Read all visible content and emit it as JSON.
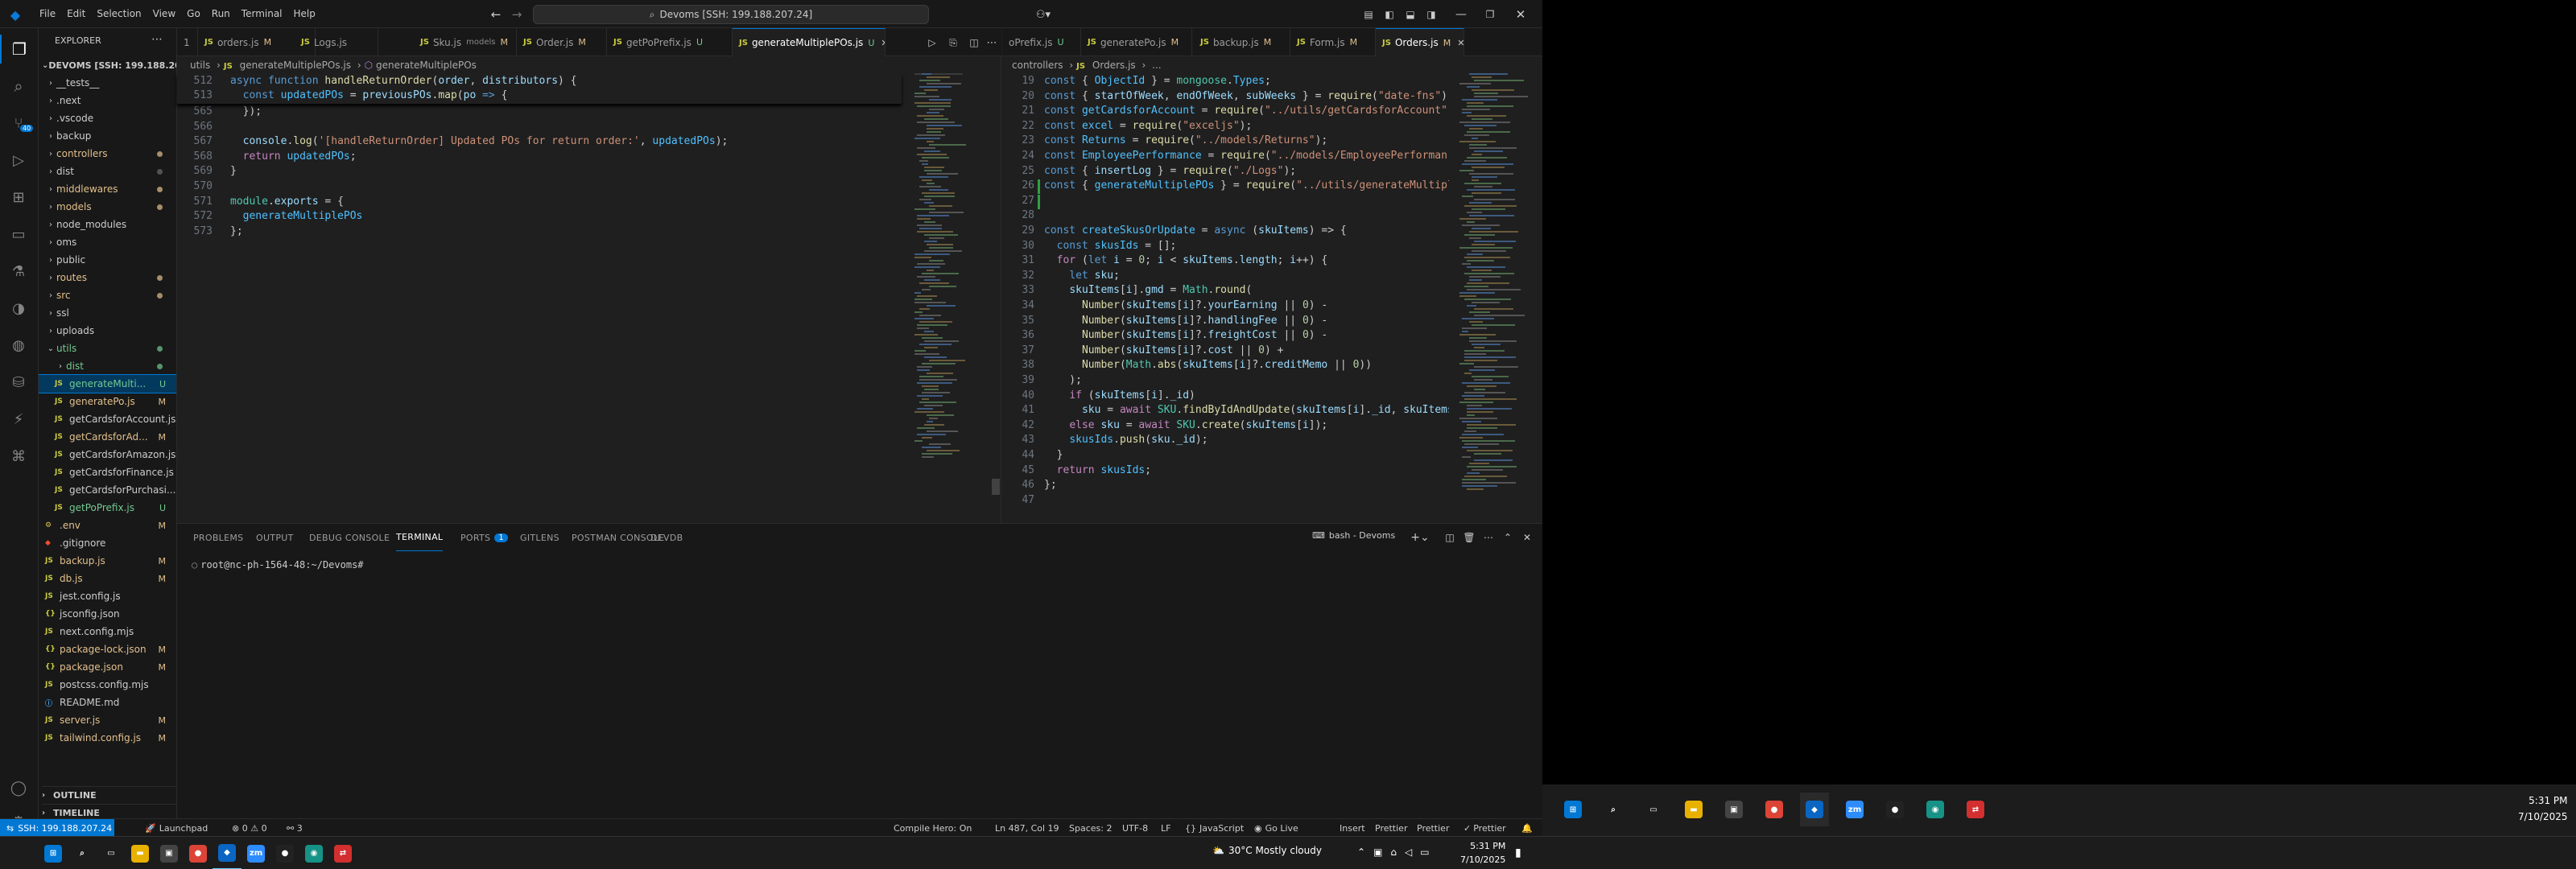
{
  "menu": {
    "file": "File",
    "edit": "Edit",
    "selection": "Selection",
    "view": "View",
    "go": "Go",
    "run": "Run",
    "terminal": "Terminal",
    "help": "Help"
  },
  "search": {
    "text": "Devoms [SSH: 199.188.207.24]"
  },
  "explorer": {
    "title": "EXPLORER",
    "root": "DEVOMS [SSH: 199.188.20...",
    "outline": "OUTLINE",
    "timeline": "TIMELINE",
    "items": [
      {
        "label": "__tests__",
        "type": "folder",
        "depth": 1,
        "status": ""
      },
      {
        "label": ".next",
        "type": "folder",
        "depth": 1,
        "status": ""
      },
      {
        "label": ".vscode",
        "type": "folder",
        "depth": 1,
        "status": ""
      },
      {
        "label": "backup",
        "type": "folder",
        "depth": 1,
        "status": ""
      },
      {
        "label": "controllers",
        "type": "folder",
        "depth": 1,
        "status": "dot",
        "color": "#e2c08d"
      },
      {
        "label": "dist",
        "type": "folder",
        "depth": 1,
        "status": "dot"
      },
      {
        "label": "middlewares",
        "type": "folder",
        "depth": 1,
        "status": "dot",
        "color": "#e2c08d"
      },
      {
        "label": "models",
        "type": "folder",
        "depth": 1,
        "status": "dot",
        "color": "#e2c08d"
      },
      {
        "label": "node_modules",
        "type": "folder",
        "depth": 1,
        "status": ""
      },
      {
        "label": "oms",
        "type": "folder",
        "depth": 1,
        "status": ""
      },
      {
        "label": "public",
        "type": "folder",
        "depth": 1,
        "status": ""
      },
      {
        "label": "routes",
        "type": "folder",
        "depth": 1,
        "status": "dot",
        "color": "#e2c08d"
      },
      {
        "label": "src",
        "type": "folder",
        "depth": 1,
        "status": "dot",
        "color": "#e2c08d"
      },
      {
        "label": "ssl",
        "type": "folder",
        "depth": 1,
        "status": ""
      },
      {
        "label": "uploads",
        "type": "folder",
        "depth": 1,
        "status": ""
      },
      {
        "label": "utils",
        "type": "folder-open",
        "depth": 1,
        "status": "dot",
        "color": "#73c991"
      },
      {
        "label": "dist",
        "type": "folder",
        "depth": 2,
        "status": "dot",
        "color": "#73c991"
      },
      {
        "label": "generateMulti...",
        "type": "js",
        "depth": 2,
        "status": "U",
        "selected": true,
        "color": "#73c991"
      },
      {
        "label": "generatePo.js",
        "type": "js",
        "depth": 2,
        "status": "M",
        "color": "#e2c08d"
      },
      {
        "label": "getCardsforAccount.js",
        "type": "js",
        "depth": 2,
        "status": ""
      },
      {
        "label": "getCardsforAd...",
        "type": "js",
        "depth": 2,
        "status": "M",
        "color": "#e2c08d"
      },
      {
        "label": "getCardsforAmazon.js",
        "type": "js",
        "depth": 2,
        "status": ""
      },
      {
        "label": "getCardsforFinance.js",
        "type": "js",
        "depth": 2,
        "status": ""
      },
      {
        "label": "getCardsforPurchasi...",
        "type": "js",
        "depth": 2,
        "status": ""
      },
      {
        "label": "getPoPrefix.js",
        "type": "js",
        "depth": 2,
        "status": "U",
        "color": "#73c991"
      },
      {
        "label": ".env",
        "type": "env",
        "depth": 1,
        "status": "M",
        "color": "#e2c08d"
      },
      {
        "label": ".gitignore",
        "type": "git",
        "depth": 1,
        "status": ""
      },
      {
        "label": "backup.js",
        "type": "js",
        "depth": 1,
        "status": "M",
        "color": "#e2c08d"
      },
      {
        "label": "db.js",
        "type": "js",
        "depth": 1,
        "status": "M",
        "color": "#e2c08d"
      },
      {
        "label": "jest.config.js",
        "type": "js",
        "depth": 1,
        "status": ""
      },
      {
        "label": "jsconfig.json",
        "type": "json",
        "depth": 1,
        "status": ""
      },
      {
        "label": "next.config.mjs",
        "type": "js",
        "depth": 1,
        "status": ""
      },
      {
        "label": "package-lock.json",
        "type": "json",
        "depth": 1,
        "status": "M",
        "color": "#e2c08d"
      },
      {
        "label": "package.json",
        "type": "json",
        "depth": 1,
        "status": "M",
        "color": "#e2c08d"
      },
      {
        "label": "postcss.config.mjs",
        "type": "js",
        "depth": 1,
        "status": ""
      },
      {
        "label": "README.md",
        "type": "md",
        "depth": 1,
        "status": ""
      },
      {
        "label": "server.js",
        "type": "js",
        "depth": 1,
        "status": "M",
        "color": "#e2c08d"
      },
      {
        "label": "tailwind.config.js",
        "type": "js",
        "depth": 1,
        "status": "M",
        "color": "#e2c08d"
      }
    ]
  },
  "tabs_left": [
    {
      "label": "1",
      "tag": "",
      "cls": "",
      "js": false
    },
    {
      "label": "orders.js",
      "tag": "M",
      "cls": "tM",
      "js": true
    },
    {
      "label": "Logs.js",
      "tag": "",
      "cls": "",
      "js": true
    },
    {
      "label": "Sku.js",
      "tag": "models",
      "cls": "dim",
      "tag2": "M",
      "js": true
    },
    {
      "label": "Order.js",
      "tag": "M",
      "cls": "tM",
      "js": true
    },
    {
      "label": "getPoPrefix.js",
      "tag": "U",
      "cls": "tU",
      "js": true
    },
    {
      "label": "generateMultiplePOs.js",
      "tag": "U",
      "cls": "tU",
      "js": true,
      "active": true
    }
  ],
  "tabs_right": [
    {
      "label": "oPrefix.js",
      "tag": "U",
      "cls": "tU",
      "js": false
    },
    {
      "label": "generatePo.js",
      "tag": "M",
      "cls": "tM",
      "js": true
    },
    {
      "label": "backup.js",
      "tag": "M",
      "cls": "tM",
      "js": true
    },
    {
      "label": "Form.js",
      "tag": "M",
      "cls": "tM",
      "js": true
    },
    {
      "label": "Orders.js",
      "tag": "M",
      "cls": "tM",
      "js": true,
      "active": true
    }
  ],
  "crumbs_left": {
    "a": "utils",
    "b": "generateMultiplePOs.js",
    "c": "generateMultiplePOs"
  },
  "crumbs_right": {
    "a": "controllers",
    "b": "Orders.js",
    "c": "..."
  },
  "left_sticky": {
    "num": "512",
    "code": "async function handleReturnOrder(order, distributors) {"
  },
  "left_sticky2": {
    "num": "513",
    "code": "  const updatedPOs = previousPOs.map(po => {"
  },
  "left_lines": [
    {
      "n": "565",
      "t": "  });"
    },
    {
      "n": "566",
      "t": ""
    },
    {
      "n": "567",
      "t": "  console.log('[handleReturnOrder] Updated POs for return order:', updatedPOs);"
    },
    {
      "n": "568",
      "t": "  return updatedPOs;"
    },
    {
      "n": "569",
      "t": "}"
    },
    {
      "n": "570",
      "t": ""
    },
    {
      "n": "571",
      "t": "module.exports = {"
    },
    {
      "n": "572",
      "t": "  generateMultiplePOs"
    },
    {
      "n": "573",
      "t": "};"
    }
  ],
  "right_lines": [
    {
      "n": "19",
      "t": "const { ObjectId } = mongoose.Types;"
    },
    {
      "n": "20",
      "t": "const { startOfWeek, endOfWeek, subWeeks } = require(\"date-fns\");"
    },
    {
      "n": "21",
      "t": "const getCardsforAccount = require(\"../utils/getCardsforAccount\""
    },
    {
      "n": "22",
      "t": "const excel = require(\"exceljs\");"
    },
    {
      "n": "23",
      "t": "const Returns = require(\"../models/Returns\");"
    },
    {
      "n": "24",
      "t": "const EmployeePerformance = require(\"../models/EmployeePerforman"
    },
    {
      "n": "25",
      "t": "const { insertLog } = require(\"./Logs\");"
    },
    {
      "n": "26",
      "t": "const { generateMultiplePOs } = require(\"../utils/generateMultipl"
    },
    {
      "n": "27",
      "t": ""
    },
    {
      "n": "28",
      "t": ""
    },
    {
      "n": "29",
      "t": "const createSkusOrUpdate = async (skuItems) => {"
    },
    {
      "n": "30",
      "t": "  const skusIds = [];"
    },
    {
      "n": "31",
      "t": "  for (let i = 0; i < skuItems.length; i++) {"
    },
    {
      "n": "32",
      "t": "    let sku;"
    },
    {
      "n": "33",
      "t": "    skuItems[i].gmd = Math.round("
    },
    {
      "n": "34",
      "t": "      Number(skuItems[i]?.yourEarning || 0) -"
    },
    {
      "n": "35",
      "t": "      Number(skuItems[i]?.handlingFee || 0) -"
    },
    {
      "n": "36",
      "t": "      Number(skuItems[i]?.freightCost || 0) -"
    },
    {
      "n": "37",
      "t": "      Number(skuItems[i]?.cost || 0) +"
    },
    {
      "n": "38",
      "t": "      Number(Math.abs(skuItems[i]?.creditMemo || 0))"
    },
    {
      "n": "39",
      "t": "    );"
    },
    {
      "n": "40",
      "t": "    if (skuItems[i]._id)"
    },
    {
      "n": "41",
      "t": "      sku = await SKU.findByIdAndUpdate(skuItems[i]._id, skuItems"
    },
    {
      "n": "42",
      "t": "    else sku = await SKU.create(skuItems[i]);"
    },
    {
      "n": "43",
      "t": "    skusIds.push(sku._id);"
    },
    {
      "n": "44",
      "t": "  }"
    },
    {
      "n": "45",
      "t": "  return skusIds;"
    },
    {
      "n": "46",
      "t": "};"
    },
    {
      "n": "47",
      "t": ""
    }
  ],
  "panel": {
    "tabs": [
      {
        "label": "PROBLEMS"
      },
      {
        "label": "OUTPUT"
      },
      {
        "label": "DEBUG CONSOLE"
      },
      {
        "label": "TERMINAL",
        "active": true
      },
      {
        "label": "PORTS",
        "badge": "1"
      },
      {
        "label": "GITLENS"
      },
      {
        "label": "POSTMAN CONSOLE"
      },
      {
        "label": "DEVDB"
      }
    ],
    "shell": "bash - Devoms",
    "prompt": "root@nc-ph-1564-48:~/Devoms#"
  },
  "status": {
    "remote": "SSH: 199.188.207.24",
    "launchpad": "Launchpad",
    "errors": "0",
    "warnings": "0",
    "ports": "3",
    "compile": "Compile Hero: On",
    "cursor": "Ln 487, Col 19",
    "spaces": "Spaces: 2",
    "encoding": "UTF-8",
    "eol": "LF",
    "lang": "JavaScript",
    "golive": "Go Live",
    "insert": "Insert",
    "prettier1": "Prettier",
    "prettier2": "Prettier",
    "prettier3": "Prettier"
  },
  "taskbar": {
    "weather": "30°C",
    "weather_desc": "Mostly cloudy",
    "time": "5:31 PM",
    "date": "7/10/2025",
    "time2": "5:31 PM",
    "date2": "7/10/2025",
    "apps": [
      {
        "name": "start",
        "label": "⊞",
        "color": "#0078d4"
      },
      {
        "name": "search",
        "label": "⌕",
        "color": "transparent"
      },
      {
        "name": "task-view",
        "label": "▭",
        "color": "transparent"
      },
      {
        "name": "file-explorer",
        "label": "▬",
        "color": "#e8b100"
      },
      {
        "name": "store",
        "label": "▣",
        "color": "#444"
      },
      {
        "name": "chrome",
        "label": "●",
        "color": "#db4437"
      },
      {
        "name": "vscode",
        "label": "◆",
        "color": "#0a66c2"
      },
      {
        "name": "zoom",
        "label": "zm",
        "color": "#2d8cff"
      },
      {
        "name": "app-bot",
        "label": "●",
        "color": "#222"
      },
      {
        "name": "app-gitkraken",
        "label": "◉",
        "color": "#179287"
      },
      {
        "name": "app-red",
        "label": "⇄",
        "color": "#d32f2f"
      }
    ]
  },
  "colors": {
    "accent": "#0078d4",
    "modified": "#e2c08d",
    "untracked": "#73c991",
    "remote": "#16825d"
  }
}
